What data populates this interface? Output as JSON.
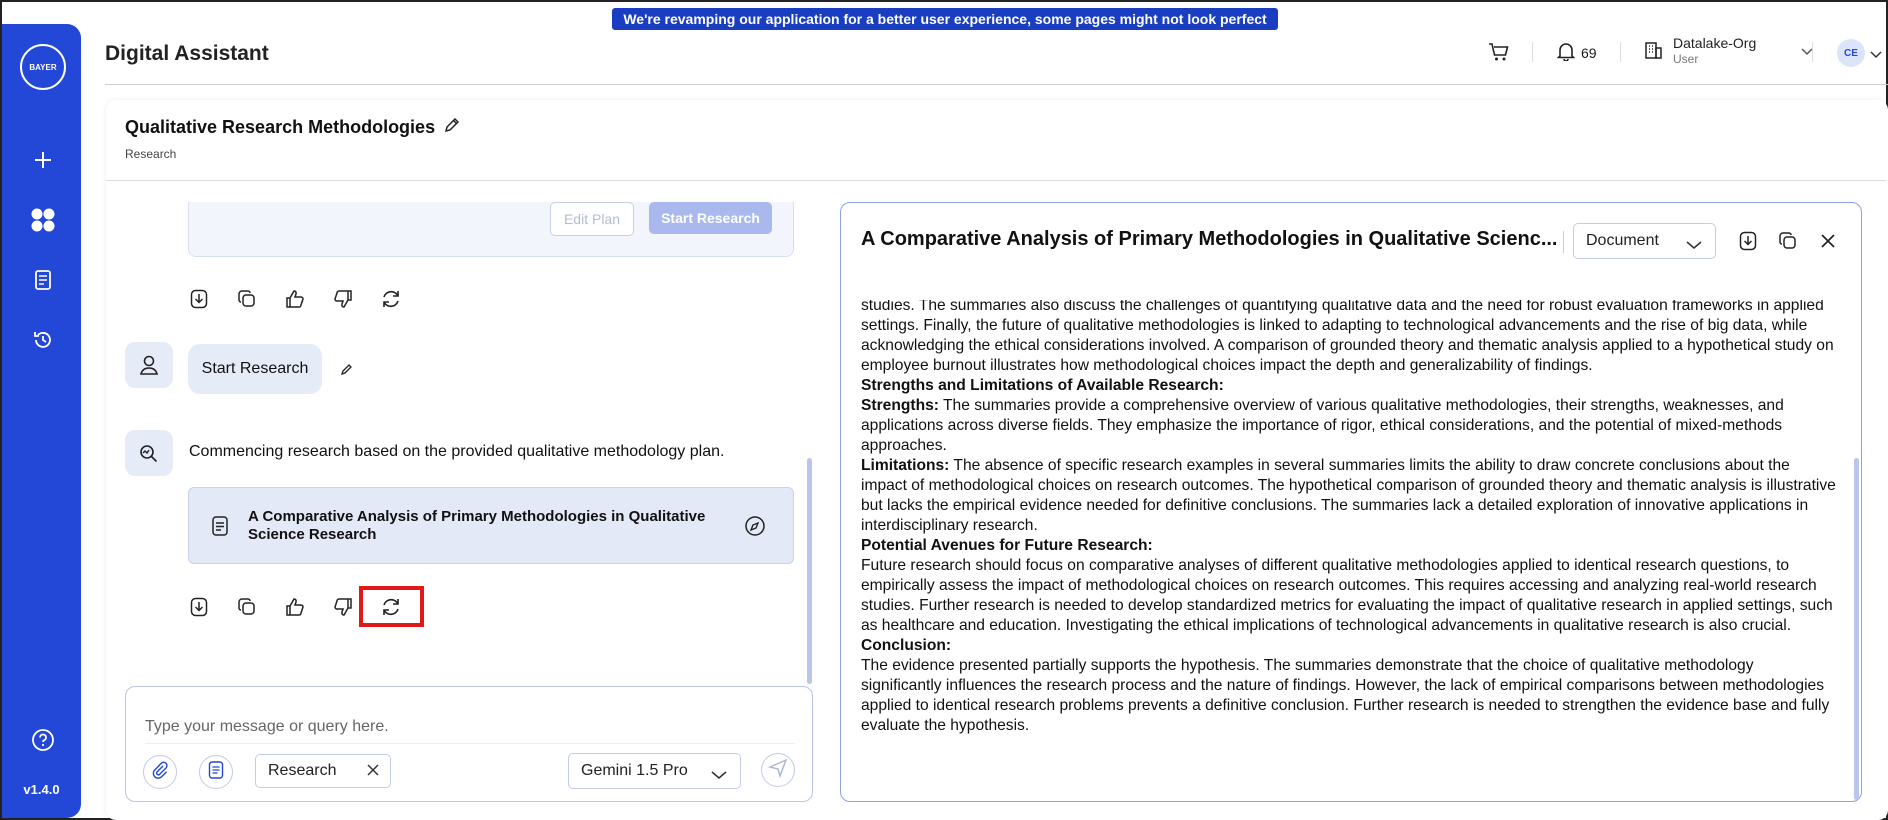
{
  "banner": "We're revamping our application for a better user experience, some pages might not look perfect yet!",
  "app": {
    "title": "Digital Assistant",
    "version": "v1.4.0",
    "logo_text": "BAYER"
  },
  "header": {
    "notifications_count": "69",
    "org_name": "Datalake-Org",
    "org_role": "User",
    "avatar_initials": "CE"
  },
  "conversation": {
    "title": "Qualitative Research Methodologies",
    "category": "Research",
    "plan_buttons": {
      "edit": "Edit Plan",
      "start": "Start Research"
    },
    "user_message": "Start Research",
    "bot_message": "Commencing research based on the provided qualitative methodology plan.",
    "doc_card_title": "A Comparative Analysis of Primary Methodologies in Qualitative Science Research"
  },
  "composer": {
    "placeholder": "Type your message or query here.",
    "chip_label": "Research",
    "model": "Gemini 1.5 Pro"
  },
  "document": {
    "title": "A Comparative Analysis of Primary Methodologies in Qualitative Scienc...",
    "view_mode": "Document",
    "intro": "studies. The summaries also discuss the challenges of quantifying qualitative data and the need for robust evaluation frameworks in applied settings. Finally, the future of qualitative methodologies is linked to adapting to technological advancements and the rise of big data, while acknowledging the ethical considerations involved. A comparison of grounded theory and thematic analysis applied to a hypothetical study on employee burnout illustrates how methodological choices impact the depth and generalizability of findings.",
    "h_strengths_limitations": "Strengths and Limitations of Available Research:",
    "strengths_label": "Strengths:",
    "strengths_text": " The summaries provide a comprehensive overview of various qualitative methodologies, their strengths, weaknesses, and applications across diverse fields. They emphasize the importance of rigor, ethical considerations, and the potential of mixed-methods approaches.",
    "limitations_label": "Limitations:",
    "limitations_text": " The absence of specific research examples in several summaries limits the ability to draw concrete conclusions about the impact of methodological choices on research outcomes. The hypothetical comparison of grounded theory and thematic analysis is illustrative but lacks the empirical evidence needed for definitive conclusions. The summaries lack a detailed exploration of innovative applications in interdisciplinary research.",
    "h_future": "Potential Avenues for Future Research:",
    "future_text": "Future research should focus on comparative analyses of different qualitative methodologies applied to identical research questions, to empirically assess the impact of methodological choices on research outcomes. This requires accessing and analyzing real-world research studies. Further research is needed to develop standardized metrics for evaluating the impact of qualitative research in applied settings, such as healthcare and education. Investigating the ethical implications of technological advancements in qualitative research is also crucial.",
    "h_conclusion": "Conclusion:",
    "conclusion_text": "The evidence presented partially supports the hypothesis. The summaries demonstrate that the choice of qualitative methodology significantly influences the research process and the nature of findings. However, the lack of empirical comparisons between methodologies applied to identical research problems prevents a definitive conclusion. Further research is needed to strengthen the evidence base and fully evaluate the hypothesis."
  },
  "colors": {
    "sidebar": "#2347d6",
    "banner": "#1a3ec2",
    "highlight": "#e01919",
    "accent_light": "#e6ebf8"
  }
}
